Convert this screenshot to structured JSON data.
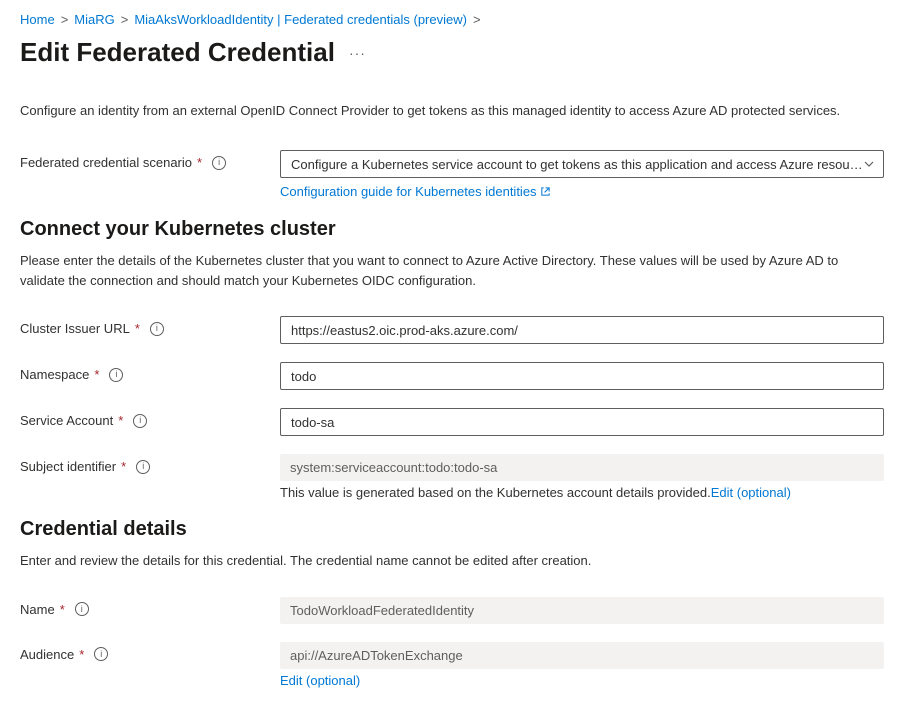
{
  "breadcrumb": {
    "home": "Home",
    "rg": "MiaRG",
    "resource": "MiaAksWorkloadIdentity | Federated credentials (preview)"
  },
  "page": {
    "title": "Edit Federated Credential",
    "intro": "Configure an identity from an external OpenID Connect Provider to get tokens as this managed identity to access Azure AD protected services."
  },
  "scenario": {
    "label": "Federated credential scenario",
    "value": "Configure a Kubernetes service account to get tokens as this application and access Azure resou…",
    "config_link": "Configuration guide for Kubernetes identities"
  },
  "connect": {
    "title": "Connect your Kubernetes cluster",
    "desc": "Please enter the details of the Kubernetes cluster that you want to connect to Azure Active Directory. These values will be used by Azure AD to validate the connection and should match your Kubernetes OIDC configuration.",
    "issuer_label": "Cluster Issuer URL",
    "issuer_value": "https://eastus2.oic.prod-aks.azure.com/",
    "namespace_label": "Namespace",
    "namespace_value": "todo",
    "service_account_label": "Service Account",
    "service_account_value": "todo-sa",
    "subject_label": "Subject identifier",
    "subject_value": "system:serviceaccount:todo:todo-sa",
    "subject_help": "This value is generated based on the Kubernetes account details provided.",
    "subject_edit": "Edit (optional)"
  },
  "details": {
    "title": "Credential details",
    "desc": "Enter and review the details for this credential. The credential name cannot be edited after creation.",
    "name_label": "Name",
    "name_value": "TodoWorkloadFederatedIdentity",
    "audience_label": "Audience",
    "audience_value": "api://AzureADTokenExchange",
    "audience_edit": "Edit (optional)"
  }
}
